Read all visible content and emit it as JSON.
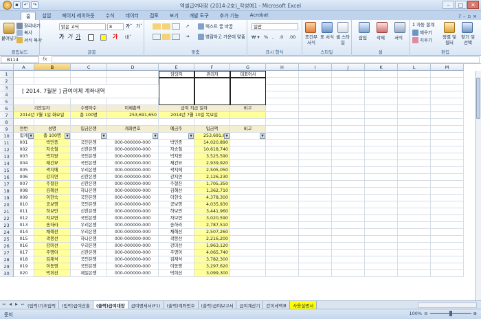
{
  "window": {
    "title": "엑셀급여대장 (2014-2호)_작성예1 - Microsoft Excel"
  },
  "ribbon_tabs": [
    "홈",
    "삽입",
    "페이지 레이아웃",
    "수식",
    "데이터",
    "검토",
    "보기",
    "개발 도구",
    "추가 기능",
    "Acrobat"
  ],
  "ribbon": {
    "clipboard": {
      "paste": "붙여넣기",
      "cut": "잘라내기",
      "copy": "복사",
      "format_painter": "서식 복사",
      "label": "클립보드"
    },
    "font": {
      "name": "맑은 고딕",
      "size": "8",
      "label": "글꼴"
    },
    "alignment": {
      "wrap": "텍스트 줄 바꿈",
      "merge": "병합하고 가운데 맞춤",
      "label": "맞춤"
    },
    "number": {
      "format": "일반",
      "label": "표시 형식"
    },
    "styles": {
      "conditional": "조건부 서식",
      "table": "표 서식",
      "cell": "셀 스타일",
      "label": "스타일"
    },
    "cells": {
      "insert": "삽입",
      "delete": "삭제",
      "format": "서식",
      "label": "셀"
    },
    "editing": {
      "autosum": "자동 합계",
      "fill": "채우기",
      "clear": "지우기",
      "sort": "정렬 및 필터",
      "find": "찾기 및 선택",
      "label": "편집"
    }
  },
  "formula_bar": {
    "namebox": "B114",
    "fx": "fx",
    "value": ""
  },
  "columns": [
    "A",
    "B",
    "C",
    "D",
    "E",
    "F",
    "G",
    "H",
    "I",
    "J",
    "K",
    "L",
    "M"
  ],
  "selected_column": "B",
  "sheet": {
    "title": "[ 2014. 7월분 ]  급여이체 계좌내역",
    "approvals": [
      "담당자",
      "관리자",
      "대표이사"
    ],
    "summary_headers": [
      "기안일자",
      "수령자수",
      "이체총액",
      "급여 지급 일자",
      "비고"
    ],
    "summary_values": [
      "2014년 7월 1일 화요일",
      "총 100명",
      "253,691,650",
      "2014년 7월 10일 목요일",
      ""
    ],
    "table_headers": [
      "연번",
      "성명",
      "입금은행",
      "계좌번호",
      "예금주",
      "입금액",
      "비고"
    ],
    "filter_row": [
      "합계",
      "총 100명",
      "",
      "",
      "",
      "253,691,65",
      ""
    ],
    "rows": [
      [
        "001",
        "박민종",
        "국민은행",
        "000-000000-000",
        "박민종",
        "14,020,890",
        ""
      ],
      [
        "002",
        "자승철",
        "신한은행",
        "000-000000-000",
        "자승철",
        "10,618,740",
        ""
      ],
      [
        "003",
        "박지왕",
        "국민은행",
        "000-000000-000",
        "박지왕",
        "3,525,590",
        ""
      ],
      [
        "004",
        "채건묘",
        "국민은행",
        "000-000000-000",
        "채건묘",
        "2,939,920",
        ""
      ],
      [
        "005",
        "곽지에",
        "우리은행",
        "000-000000-000",
        "곽지에",
        "2,505,050",
        ""
      ],
      [
        "006",
        "강지연",
        "신한은행",
        "000-000000-000",
        "강지연",
        "2,126,230",
        ""
      ],
      [
        "007",
        "주형진",
        "신한은행",
        "000-000000-000",
        "주형진",
        "1,705,350",
        ""
      ],
      [
        "008",
        "김혜선",
        "하나은행",
        "000-000000-000",
        "김혜선",
        "1,362,710",
        ""
      ],
      [
        "009",
        "이현숙",
        "국민은행",
        "000-000000-000",
        "이현숙",
        "4,378,300",
        ""
      ],
      [
        "010",
        "공보영",
        "국민은행",
        "000-000000-000",
        "공보영",
        "4,035,930",
        ""
      ],
      [
        "011",
        "하보민",
        "신한은행",
        "000-000000-000",
        "하보민",
        "3,441,960",
        ""
      ],
      [
        "012",
        "자보연",
        "국민은행",
        "000-000000-000",
        "자보연",
        "3,020,590",
        ""
      ],
      [
        "013",
        "송하라",
        "우리은행",
        "000-000000-000",
        "송하라",
        "2,787,510",
        ""
      ],
      [
        "014",
        "채혜선",
        "우리은행",
        "000-000000-000",
        "채혜선",
        "2,507,260",
        ""
      ],
      [
        "015",
        "곽봉선",
        "하나은행",
        "000-000000-000",
        "곽봉선",
        "2,216,200",
        ""
      ],
      [
        "016",
        "강미선",
        "우리은행",
        "000-000000-000",
        "강미선",
        "1,963,120",
        ""
      ],
      [
        "017",
        "주명이",
        "신한은행",
        "000-000000-000",
        "주명이",
        "4,065,740",
        ""
      ],
      [
        "018",
        "김재석",
        "국민은행",
        "000-000000-000",
        "김재석",
        "3,782,300",
        ""
      ],
      [
        "019",
        "이동영",
        "국민은행",
        "000-000000-000",
        "이동영",
        "3,297,620",
        ""
      ],
      [
        "020",
        "박희선",
        "제일은행",
        "000-000000-000",
        "박희선",
        "3,099,300",
        ""
      ]
    ]
  },
  "row_numbers": [
    "1",
    "2",
    "3",
    "4",
    "5",
    "6",
    "7",
    "8",
    "9",
    "10",
    "11",
    "12",
    "13",
    "14",
    "15",
    "16",
    "17",
    "18",
    "19",
    "20",
    "21",
    "22",
    "23",
    "24",
    "25",
    "26",
    "27",
    "28",
    "29",
    "30"
  ],
  "sheet_tabs": [
    "(입력)기초입력",
    "(입력)급여산출",
    "(출력)급여대장",
    "급여명세서(F1)",
    "(출력)계좌번호",
    "(출력)급여보고서",
    "급여계산기",
    "간이세액표",
    "사용설명서"
  ],
  "active_sheet_index": 2,
  "status": {
    "ready": "준비",
    "zoom": "100%"
  }
}
